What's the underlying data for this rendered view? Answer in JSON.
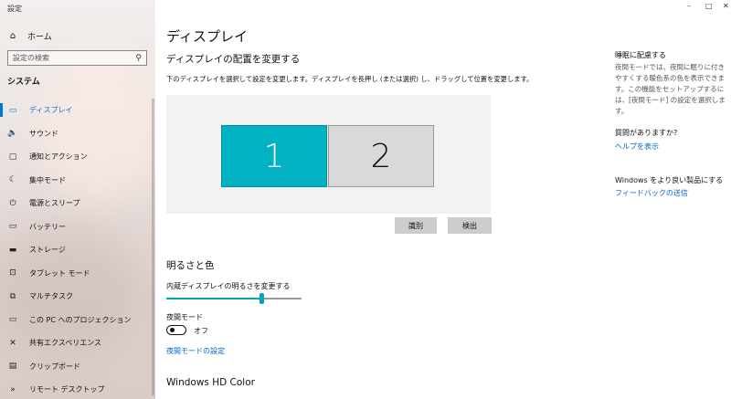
{
  "window": {
    "title": "設定",
    "controls": {
      "minimize": "–",
      "maximize": "□",
      "close": "✕"
    }
  },
  "sidebar": {
    "home_label": "ホーム",
    "search_placeholder": "設定の検索",
    "section": "システム",
    "items": [
      {
        "label": "ディスプレイ",
        "icon": "monitor-icon",
        "glyph": "▭",
        "active": true
      },
      {
        "label": "サウンド",
        "icon": "speaker-icon",
        "glyph": "🔈",
        "active": false
      },
      {
        "label": "通知とアクション",
        "icon": "notification-icon",
        "glyph": "▢",
        "active": false
      },
      {
        "label": "集中モード",
        "icon": "moon-icon",
        "glyph": "☾",
        "active": false
      },
      {
        "label": "電源とスリープ",
        "icon": "power-icon",
        "glyph": "⏻",
        "active": false
      },
      {
        "label": "バッテリー",
        "icon": "battery-icon",
        "glyph": "▭",
        "active": false
      },
      {
        "label": "ストレージ",
        "icon": "storage-icon",
        "glyph": "▬",
        "active": false
      },
      {
        "label": "タブレット モード",
        "icon": "tablet-icon",
        "glyph": "⊡",
        "active": false
      },
      {
        "label": "マルチタスク",
        "icon": "multitask-icon",
        "glyph": "⧉",
        "active": false
      },
      {
        "label": "この PC へのプロジェクション",
        "icon": "projection-icon",
        "glyph": "▭",
        "active": false
      },
      {
        "label": "共有エクスペリエンス",
        "icon": "share-icon",
        "glyph": "✕",
        "active": false
      },
      {
        "label": "クリップボード",
        "icon": "clipboard-icon",
        "glyph": "▤",
        "active": false
      },
      {
        "label": "リモート デスクトップ",
        "icon": "remote-icon",
        "glyph": "»",
        "active": false
      }
    ]
  },
  "main": {
    "title": "ディスプレイ",
    "arrange_heading": "ディスプレイの配置を変更する",
    "arrange_desc": "下のディスプレイを選択して設定を変更します。ディスプレイを長押し (または選択) し、ドラッグして位置を変更します。",
    "monitors": [
      "1",
      "2"
    ],
    "identify_label": "識別",
    "detect_label": "検出",
    "brightness_heading": "明るさと色",
    "brightness_label": "内蔵ディスプレイの明るさを変更する",
    "brightness_level": 0.7,
    "night_label": "夜間モード",
    "night_state": "オフ",
    "night_link": "夜間モードの設定",
    "hd_color": "Windows HD Color"
  },
  "aside": {
    "sleep_heading": "睡眠に配慮する",
    "sleep_text": "夜間モードでは、夜間に眠りに付きやすくする暖色系の色を表示できます。この機能をセットアップするには、[夜間モード] の設定を選択します。",
    "question_heading": "質問がありますか?",
    "help_link": "ヘルプを表示",
    "improve_heading": "Windows をより良い製品にする",
    "feedback_link": "フィードバックの送信"
  },
  "colors": {
    "accent": "#0078d7",
    "selected_monitor": "#00b2c2",
    "link": "#0066cc"
  }
}
